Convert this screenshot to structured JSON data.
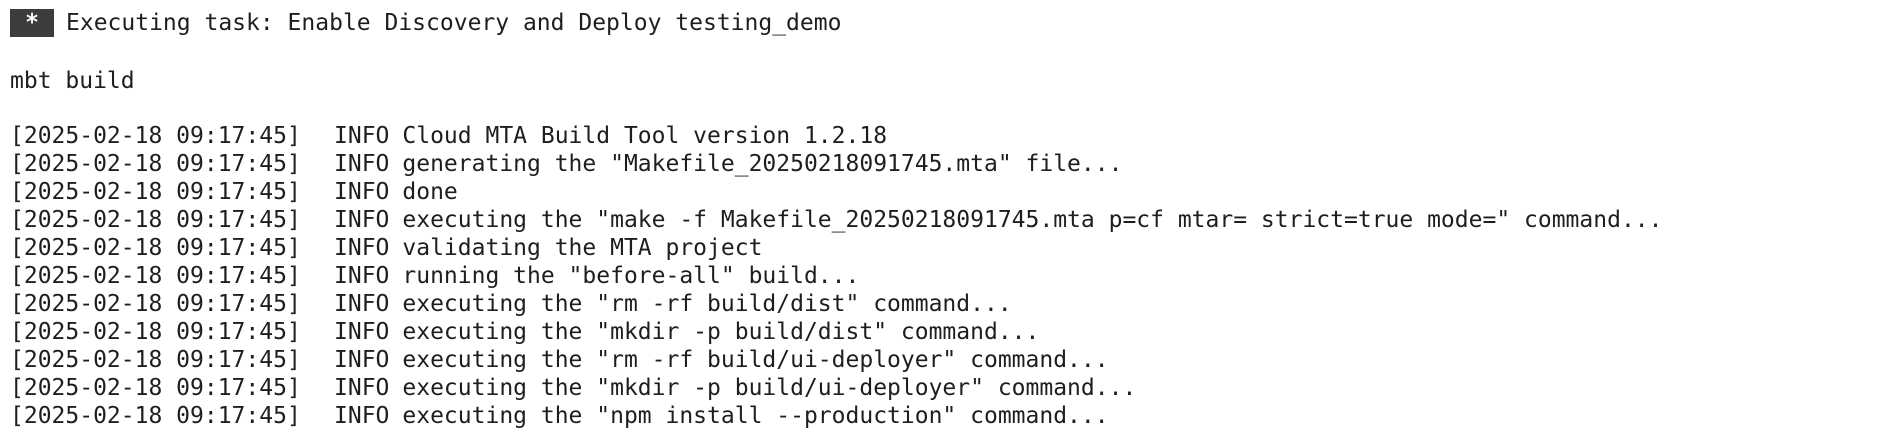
{
  "task": {
    "badge": "*",
    "title": "Executing task: Enable Discovery and Deploy testing_demo"
  },
  "command": "mbt build",
  "log": [
    {
      "timestamp": "[2025-02-18 09:17:45]",
      "level": "INFO",
      "message": "Cloud MTA Build Tool version 1.2.18"
    },
    {
      "timestamp": "[2025-02-18 09:17:45]",
      "level": "INFO",
      "message": "generating the \"Makefile_20250218091745.mta\" file..."
    },
    {
      "timestamp": "[2025-02-18 09:17:45]",
      "level": "INFO",
      "message": "done"
    },
    {
      "timestamp": "[2025-02-18 09:17:45]",
      "level": "INFO",
      "message": "executing the \"make -f Makefile_20250218091745.mta p=cf mtar= strict=true mode=\" command..."
    },
    {
      "timestamp": "[2025-02-18 09:17:45]",
      "level": "INFO",
      "message": "validating the MTA project"
    },
    {
      "timestamp": "[2025-02-18 09:17:45]",
      "level": "INFO",
      "message": "running the \"before-all\" build..."
    },
    {
      "timestamp": "[2025-02-18 09:17:45]",
      "level": "INFO",
      "message": "executing the \"rm -rf build/dist\" command..."
    },
    {
      "timestamp": "[2025-02-18 09:17:45]",
      "level": "INFO",
      "message": "executing the \"mkdir -p build/dist\" command..."
    },
    {
      "timestamp": "[2025-02-18 09:17:45]",
      "level": "INFO",
      "message": "executing the \"rm -rf build/ui-deployer\" command..."
    },
    {
      "timestamp": "[2025-02-18 09:17:45]",
      "level": "INFO",
      "message": "executing the \"mkdir -p build/ui-deployer\" command..."
    },
    {
      "timestamp": "[2025-02-18 09:17:45]",
      "level": "INFO",
      "message": "executing the \"npm install --production\" command..."
    }
  ]
}
